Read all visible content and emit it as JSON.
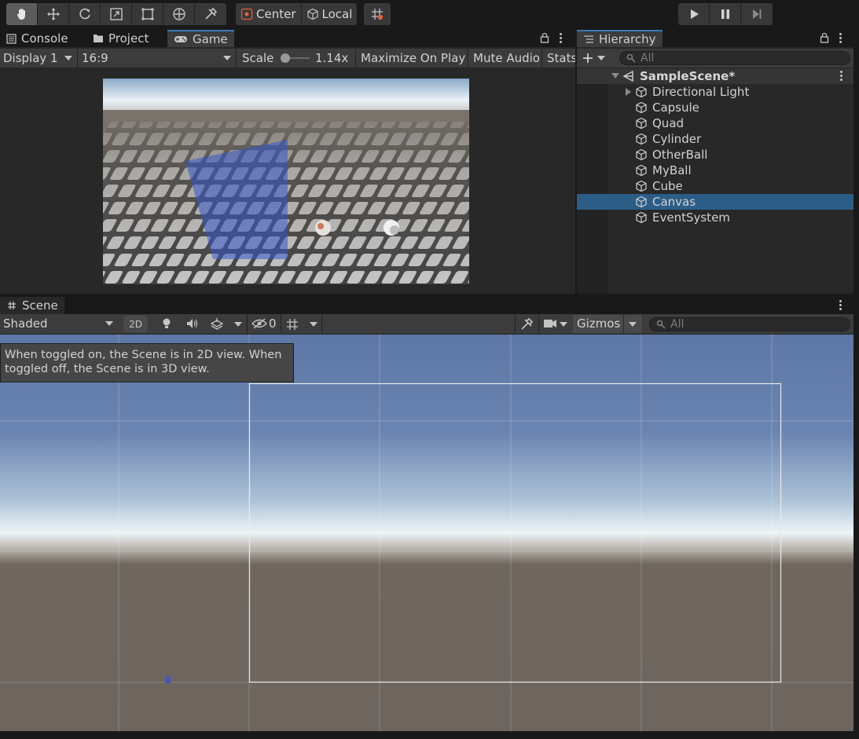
{
  "toolbar": {
    "tools": [
      "hand-icon",
      "move-icon",
      "rotate-icon",
      "scale-icon",
      "rect-icon",
      "transform-icon",
      "custom-tool-icon"
    ],
    "pivot_center": "Center",
    "pivot_local": "Local",
    "grid_snap": "grid-snap-icon",
    "play": "play-icon",
    "pause": "pause-icon",
    "step": "step-icon"
  },
  "left_tabs": {
    "console": "Console",
    "project": "Project",
    "game": "Game"
  },
  "game_bar": {
    "display": "Display 1",
    "aspect": "16:9",
    "scale_label": "Scale",
    "scale_value": "1.14x",
    "maximize": "Maximize On Play",
    "mute": "Mute Audio",
    "stats": "Stats"
  },
  "hierarchy": {
    "title": "Hierarchy",
    "search_placeholder": "All",
    "scene": "SampleScene*",
    "items": [
      {
        "label": "Directional Light",
        "expandable": true,
        "selected": false
      },
      {
        "label": "Capsule",
        "expandable": false,
        "selected": false
      },
      {
        "label": "Quad",
        "expandable": false,
        "selected": false
      },
      {
        "label": "Cylinder",
        "expandable": false,
        "selected": false
      },
      {
        "label": "OtherBall",
        "expandable": false,
        "selected": false
      },
      {
        "label": "MyBall",
        "expandable": false,
        "selected": false
      },
      {
        "label": "Cube",
        "expandable": false,
        "selected": false
      },
      {
        "label": "Canvas",
        "expandable": false,
        "selected": true
      },
      {
        "label": "EventSystem",
        "expandable": false,
        "selected": false
      }
    ]
  },
  "scene_panel": {
    "tab": "Scene",
    "shading": "Shaded",
    "mode_2d": "2D",
    "hidden_count": "0",
    "gizmos": "Gizmos",
    "search_placeholder": "All",
    "tooltip": "When toggled on, the Scene is in 2D view. When toggled off, the Scene is in 3D view."
  },
  "colors": {
    "selection": "#2c5d87",
    "panel": "#3c3c3c",
    "accent": "#3a79bb"
  }
}
